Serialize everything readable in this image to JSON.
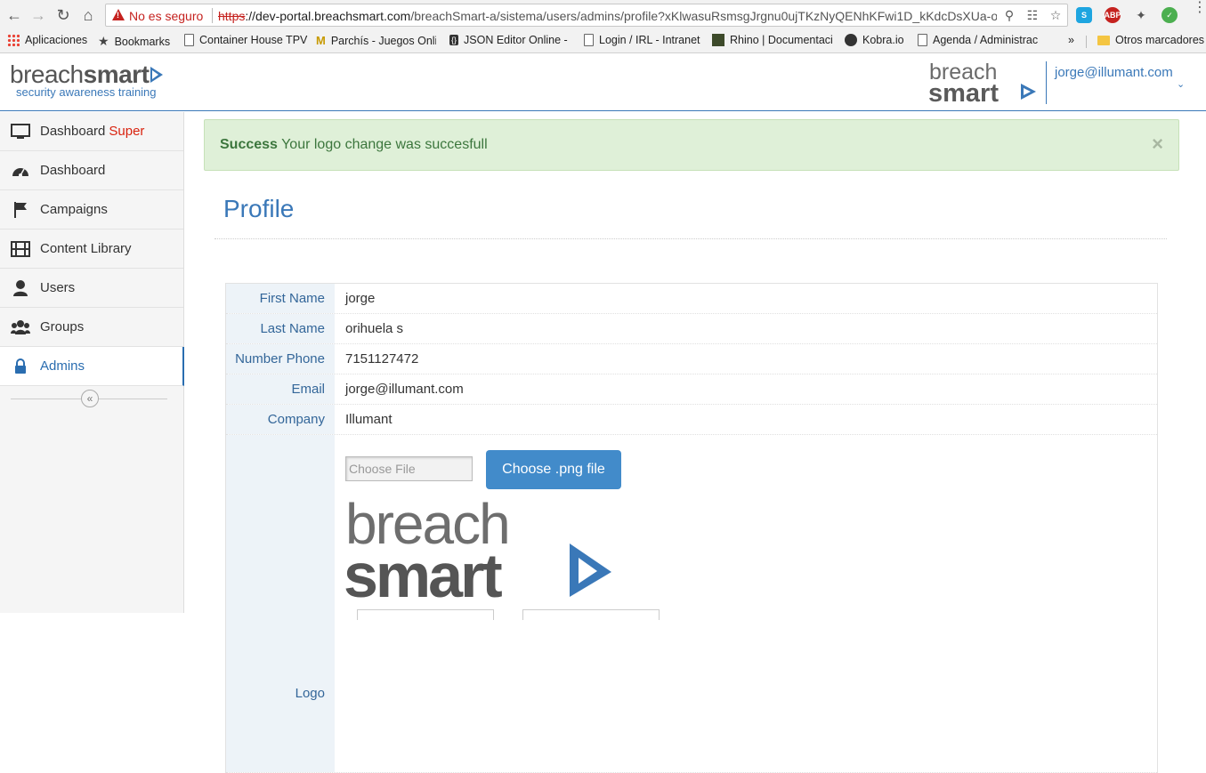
{
  "browser": {
    "security_label": "No es seguro",
    "url_scheme": "https",
    "url_host": "://dev-portal.breachsmart.com",
    "url_path": "/breachSmart-a/sistema/users/admins/profile?xKlwasuRsmsgJrgnu0ujTKzNyQENhKFwi1D_kKdcDsXUa-o...",
    "bookmarks": [
      {
        "label": "Aplicaciones",
        "icon": "apps-grid-icon"
      },
      {
        "label": "Bookmarks",
        "icon": "star-icon"
      },
      {
        "label": "Container House TPV",
        "icon": "page-icon"
      },
      {
        "label": "Parchís - Juegos Onli",
        "icon": "parchis-icon"
      },
      {
        "label": "JSON Editor Online -",
        "icon": "json-icon"
      },
      {
        "label": "Login / IRL - Intranet",
        "icon": "page-icon"
      },
      {
        "label": "Rhino | Documentaci",
        "icon": "rhino-icon"
      },
      {
        "label": "Kobra.io",
        "icon": "kobra-icon"
      },
      {
        "label": "Agenda / Administrac",
        "icon": "page-icon"
      }
    ],
    "more_label": "»",
    "other_bookmarks": "Otros marcadores"
  },
  "header": {
    "brand_breach": "breach",
    "brand_smart": "smart",
    "brand_tagline": "security awareness training",
    "user_email": "jorge@illumant.com"
  },
  "sidebar": {
    "items": [
      {
        "label": "Dashboard",
        "suffix": "Super",
        "icon": "monitor-icon"
      },
      {
        "label": "Dashboard",
        "suffix": "",
        "icon": "speedometer-icon"
      },
      {
        "label": "Campaigns",
        "suffix": "",
        "icon": "flag-icon"
      },
      {
        "label": "Content Library",
        "suffix": "",
        "icon": "film-icon"
      },
      {
        "label": "Users",
        "suffix": "",
        "icon": "user-icon"
      },
      {
        "label": "Groups",
        "suffix": "",
        "icon": "group-icon"
      },
      {
        "label": "Admins",
        "suffix": "",
        "icon": "lock-icon"
      }
    ],
    "collapse_glyph": "«"
  },
  "alert": {
    "strong": "Success",
    "message": "Your logo change was succesfull",
    "close_glyph": "×"
  },
  "page": {
    "title": "Profile"
  },
  "profile": {
    "rows": [
      {
        "label": "First Name",
        "value": "jorge"
      },
      {
        "label": "Last Name",
        "value": "orihuela s"
      },
      {
        "label": "Number Phone",
        "value": "7151127472"
      },
      {
        "label": "Email",
        "value": "jorge@illumant.com"
      },
      {
        "label": "Company",
        "value": "Illumant"
      }
    ],
    "logo_label": "Logo",
    "file_placeholder": "Choose File",
    "choose_button": "Choose .png file",
    "logo_breach": "breach",
    "logo_smart": "smart"
  },
  "colors": {
    "accent": "#3a78b8",
    "alert_bg": "#dff0d8",
    "alert_text": "#3c763d",
    "button": "#428bca",
    "super_red": "#d9230f"
  }
}
